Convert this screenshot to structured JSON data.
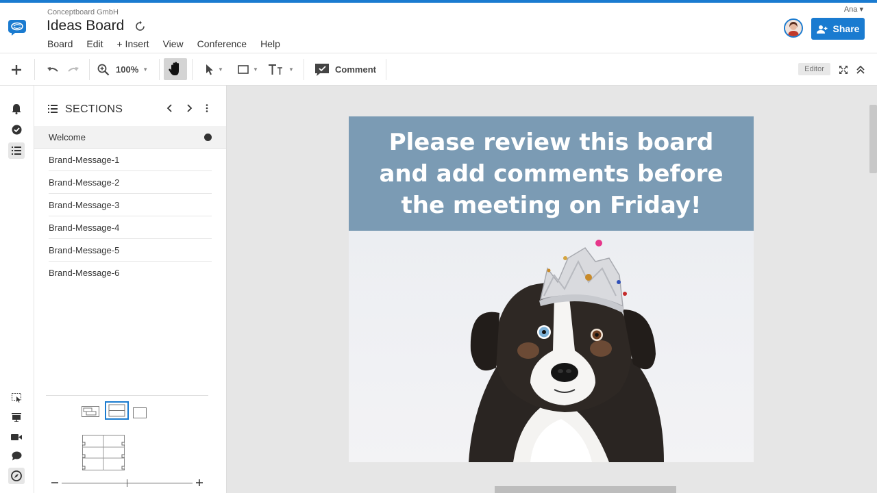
{
  "header": {
    "company": "Conceptboard GmbH",
    "board_title": "Ideas Board",
    "user_name": "Ana ▾",
    "share_label": "Share",
    "menu": [
      "Board",
      "Edit",
      "+ Insert",
      "View",
      "Conference",
      "Help"
    ]
  },
  "toolbar": {
    "zoom": "100%",
    "comment_label": "Comment",
    "mode_badge": "Editor"
  },
  "rail": {
    "icons": [
      "bell-icon",
      "check-circle-icon",
      "list-icon",
      "select-area-icon",
      "presentation-icon",
      "video-icon",
      "chat-icon",
      "compass-icon"
    ]
  },
  "sections_panel": {
    "title": "SECTIONS",
    "items": [
      "Welcome",
      "Brand-Message-1",
      "Brand-Message-2",
      "Brand-Message-3",
      "Brand-Message-4",
      "Brand-Message-5",
      "Brand-Message-6"
    ],
    "active_index": 0
  },
  "canvas": {
    "banner_text": "Please review this board and add comments before the meeting on Friday!"
  },
  "colors": {
    "accent": "#1a7bd0",
    "banner": "#7b9bb4",
    "canvas_bg": "#e6e6e6"
  }
}
